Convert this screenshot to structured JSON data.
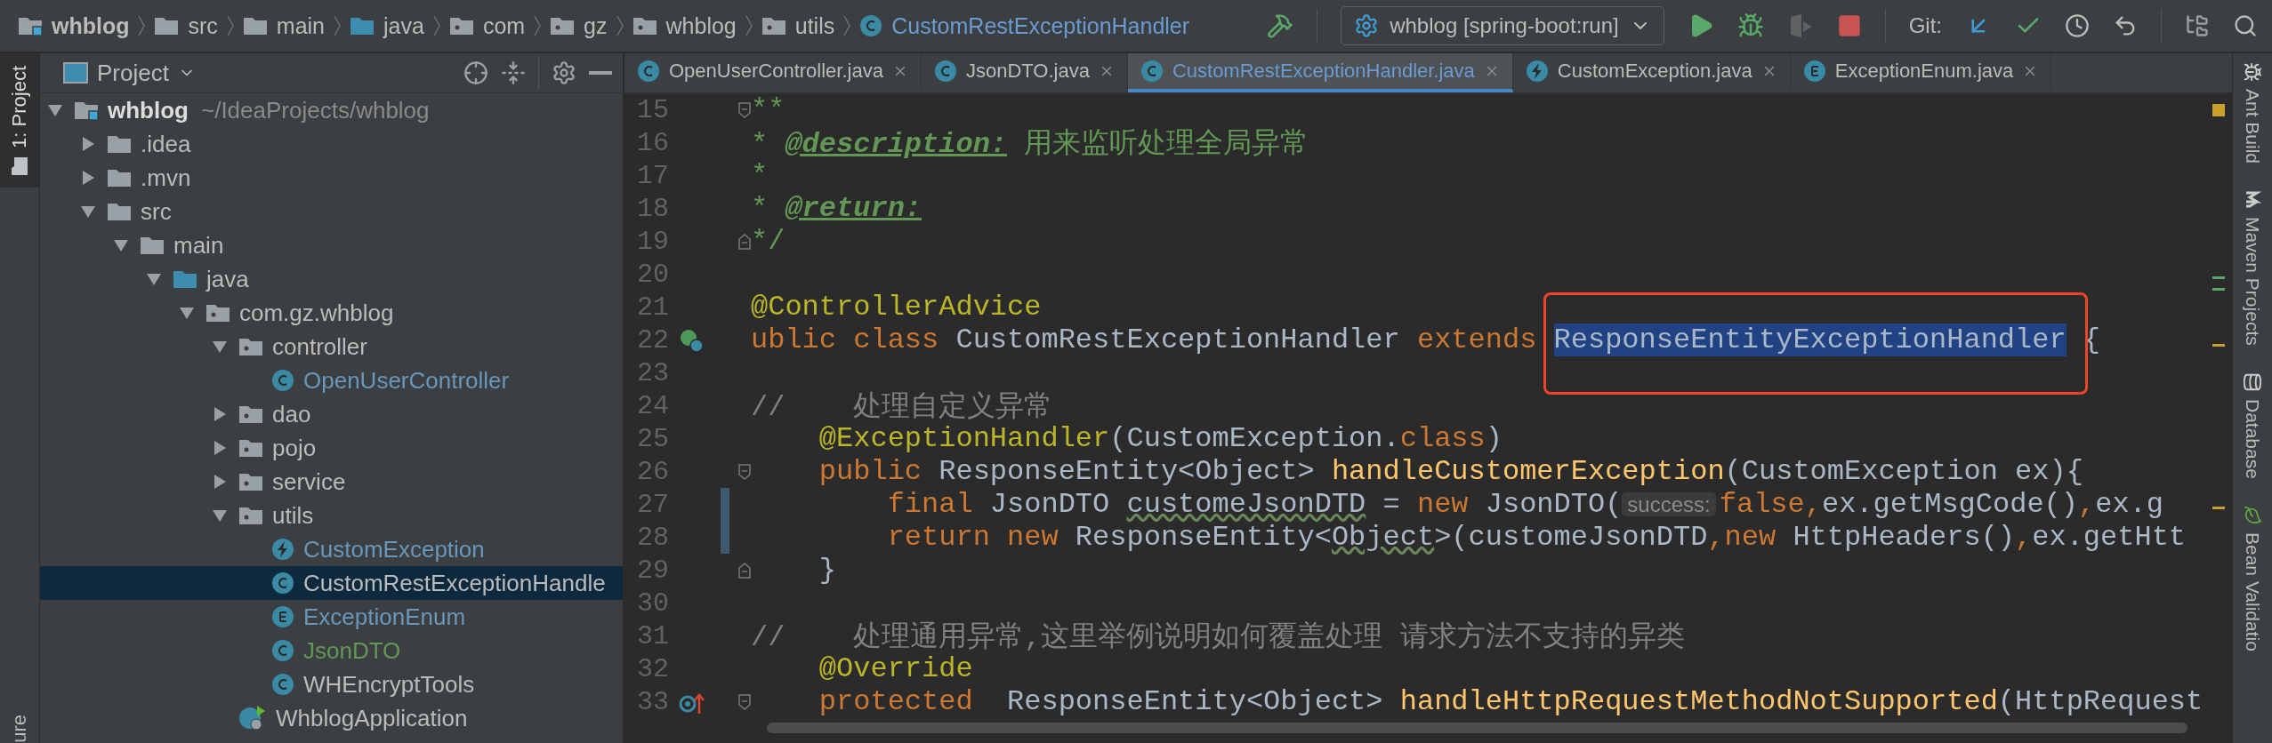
{
  "breadcrumbs": [
    {
      "label": "whblog",
      "kind": "module"
    },
    {
      "label": "src",
      "kind": "folder"
    },
    {
      "label": "main",
      "kind": "folder"
    },
    {
      "label": "java",
      "kind": "source"
    },
    {
      "label": "com",
      "kind": "package"
    },
    {
      "label": "gz",
      "kind": "package"
    },
    {
      "label": "whblog",
      "kind": "package"
    },
    {
      "label": "utils",
      "kind": "package"
    },
    {
      "label": "CustomRestExceptionHandler",
      "kind": "class"
    }
  ],
  "toolbar": {
    "run_config": "whblog [spring-boot:run]",
    "git_label": "Git:"
  },
  "left_stripe": {
    "tabs": [
      {
        "label": "1: Project",
        "selected": true
      }
    ],
    "bottom_label": "ure"
  },
  "project_panel": {
    "title": "Project",
    "tree": [
      {
        "label": "whblog",
        "hint": "~/IdeaProjects/whblog",
        "kind": "module",
        "expanded": true,
        "selected": false,
        "children": [
          {
            "label": ".idea",
            "kind": "folder",
            "expanded": false,
            "selected": false
          },
          {
            "label": ".mvn",
            "kind": "folder",
            "expanded": false,
            "selected": false
          },
          {
            "label": "src",
            "kind": "folder",
            "expanded": true,
            "selected": false,
            "children": [
              {
                "label": "main",
                "kind": "folder",
                "expanded": true,
                "selected": false,
                "children": [
                  {
                    "label": "java",
                    "kind": "source",
                    "expanded": true,
                    "selected": false,
                    "children": [
                      {
                        "label": "com.gz.whblog",
                        "kind": "package",
                        "expanded": true,
                        "selected": false,
                        "children": [
                          {
                            "label": "controller",
                            "kind": "package",
                            "expanded": true,
                            "selected": false,
                            "children": [
                              {
                                "label": "OpenUserController",
                                "kind": "class",
                                "color": "#6897bb",
                                "selected": false
                              }
                            ]
                          },
                          {
                            "label": "dao",
                            "kind": "package",
                            "expanded": false,
                            "selected": false
                          },
                          {
                            "label": "pojo",
                            "kind": "package",
                            "expanded": false,
                            "selected": false
                          },
                          {
                            "label": "service",
                            "kind": "package",
                            "expanded": false,
                            "selected": false
                          },
                          {
                            "label": "utils",
                            "kind": "package",
                            "expanded": true,
                            "selected": false,
                            "children": [
                              {
                                "label": "CustomException",
                                "kind": "exception",
                                "color": "#6897bb",
                                "selected": false
                              },
                              {
                                "label": "CustomRestExceptionHandle",
                                "kind": "class",
                                "color": "#bbbbbb",
                                "selected": true
                              },
                              {
                                "label": "ExceptionEnum",
                                "kind": "enum",
                                "color": "#6897bb",
                                "selected": false
                              },
                              {
                                "label": "JsonDTO",
                                "kind": "class",
                                "color": "#629755",
                                "selected": false
                              },
                              {
                                "label": "WHEncryptTools",
                                "kind": "class",
                                "color": "#bbbbbb",
                                "selected": false
                              }
                            ]
                          },
                          {
                            "label": "WhblogApplication",
                            "kind": "app",
                            "color": "#bbbbbb",
                            "selected": false
                          }
                        ]
                      }
                    ]
                  }
                ]
              }
            ]
          }
        ]
      }
    ]
  },
  "editor": {
    "tabs": [
      {
        "label": "OpenUserController.java",
        "kind": "class",
        "selected": false
      },
      {
        "label": "JsonDTO.java",
        "kind": "class",
        "selected": false
      },
      {
        "label": "CustomRestExceptionHandler.java",
        "kind": "class",
        "selected": true
      },
      {
        "label": "CustomException.java",
        "kind": "exception",
        "selected": false
      },
      {
        "label": "ExceptionEnum.java",
        "kind": "enum",
        "selected": false
      }
    ],
    "lines": [
      {
        "number": "15",
        "changed": false,
        "fold": {
          "kind": "start"
        },
        "tokens": [
          {
            "kind": "doc",
            "text": "**"
          }
        ]
      },
      {
        "number": "16",
        "changed": false,
        "tokens": [
          {
            "kind": "doc",
            "text": "* "
          },
          {
            "kind": "doctag",
            "text": "@description:"
          },
          {
            "kind": "doc",
            "text": " 用来监听处理全局异常"
          }
        ]
      },
      {
        "number": "17",
        "changed": false,
        "tokens": [
          {
            "kind": "doc",
            "text": "*"
          }
        ]
      },
      {
        "number": "18",
        "changed": false,
        "tokens": [
          {
            "kind": "doc",
            "text": "* "
          },
          {
            "kind": "doctag",
            "text": "@return:"
          }
        ]
      },
      {
        "number": "19",
        "changed": false,
        "fold": {
          "kind": "end"
        },
        "tokens": [
          {
            "kind": "doc",
            "text": "*/"
          }
        ]
      },
      {
        "number": "20",
        "changed": false
      },
      {
        "number": "21",
        "changed": false,
        "tokens": [
          {
            "kind": "annotation",
            "text": "@ControllerAdvice"
          }
        ]
      },
      {
        "number": "22",
        "changed": false,
        "gutter": {
          "kind": "bean"
        },
        "tokens": [
          {
            "kind": "keyword",
            "text": "ublic class "
          },
          {
            "kind": "plain",
            "text": "CustomRestExceptionHandler "
          },
          {
            "kind": "keyword",
            "text": "extends "
          },
          {
            "kind": "selected",
            "text": "ResponseEntityExceptionHandler"
          },
          {
            "kind": "plain",
            "text": " {"
          }
        ]
      },
      {
        "number": "23",
        "changed": false
      },
      {
        "number": "24",
        "changed": false,
        "tokens": [
          {
            "kind": "comment",
            "text": "//    处理自定义异常"
          }
        ]
      },
      {
        "number": "25",
        "changed": false,
        "tokens": [
          {
            "kind": "annotation",
            "text": "    @ExceptionHandler"
          },
          {
            "kind": "plain",
            "text": "(CustomException."
          },
          {
            "kind": "keyword",
            "text": "class"
          },
          {
            "kind": "plain",
            "text": ")"
          }
        ]
      },
      {
        "number": "26",
        "changed": false,
        "fold": {
          "kind": "start"
        },
        "tokens": [
          {
            "kind": "keyword",
            "text": "    public "
          },
          {
            "kind": "plain",
            "text": "ResponseEntity<Object> "
          },
          {
            "kind": "method",
            "text": "handleCustomerException"
          },
          {
            "kind": "plain",
            "text": "(CustomException ex){"
          }
        ]
      },
      {
        "number": "27",
        "changed": true,
        "tokens": [
          {
            "kind": "keyword",
            "text": "        final "
          },
          {
            "kind": "plain",
            "text": "JsonDTO "
          },
          {
            "kind": "typo",
            "text": "customeJsonDTD"
          },
          {
            "kind": "plain",
            "text": " = "
          },
          {
            "kind": "keyword",
            "text": "new "
          },
          {
            "kind": "plain",
            "text": "JsonDTO("
          },
          {
            "kind": "hint",
            "text": "success:"
          },
          {
            "kind": "keyword",
            "text": "false,"
          },
          {
            "kind": "plain",
            "text": "ex.getMsgCode()"
          },
          {
            "kind": "keyword",
            "text": ","
          },
          {
            "kind": "plain",
            "text": "ex.g"
          }
        ]
      },
      {
        "number": "28",
        "changed": true,
        "tokens": [
          {
            "kind": "keyword",
            "text": "        return new "
          },
          {
            "kind": "plain",
            "text": "ResponseEntity<"
          },
          {
            "kind": "typo",
            "text": "Object"
          },
          {
            "kind": "plain",
            "text": ">(customeJsonDTD"
          },
          {
            "kind": "keyword",
            "text": ",new "
          },
          {
            "kind": "plain",
            "text": "HttpHeaders()"
          },
          {
            "kind": "keyword",
            "text": ","
          },
          {
            "kind": "plain",
            "text": "ex.getHtt"
          }
        ]
      },
      {
        "number": "29",
        "changed": false,
        "fold": {
          "kind": "end"
        },
        "tokens": [
          {
            "kind": "plain",
            "text": "    }"
          }
        ]
      },
      {
        "number": "30",
        "changed": false
      },
      {
        "number": "31",
        "changed": false,
        "tokens": [
          {
            "kind": "comment",
            "text": "//    处理通用异常,这里举例说明如何覆盖处理 请求方法不支持的异类"
          }
        ]
      },
      {
        "number": "32",
        "changed": false,
        "tokens": [
          {
            "kind": "annotation",
            "text": "    @Override"
          }
        ]
      },
      {
        "number": "33",
        "changed": false,
        "gutter": {
          "kind": "override"
        },
        "fold": {
          "kind": "start"
        },
        "tokens": [
          {
            "kind": "keyword",
            "text": "    protected  "
          },
          {
            "kind": "plain",
            "text": "ResponseEntity<Object> "
          },
          {
            "kind": "method",
            "text": "handleHttpRequestMethodNotSupported"
          },
          {
            "kind": "plain",
            "text": "(HttpRequest"
          }
        ]
      }
    ]
  },
  "right_stripe": [
    {
      "label": "Ant Build",
      "kind": "ant"
    },
    {
      "label": "Maven Projects",
      "kind": "maven"
    },
    {
      "label": "Database",
      "kind": "database"
    },
    {
      "label": "Bean Validatio",
      "kind": "bean"
    }
  ]
}
